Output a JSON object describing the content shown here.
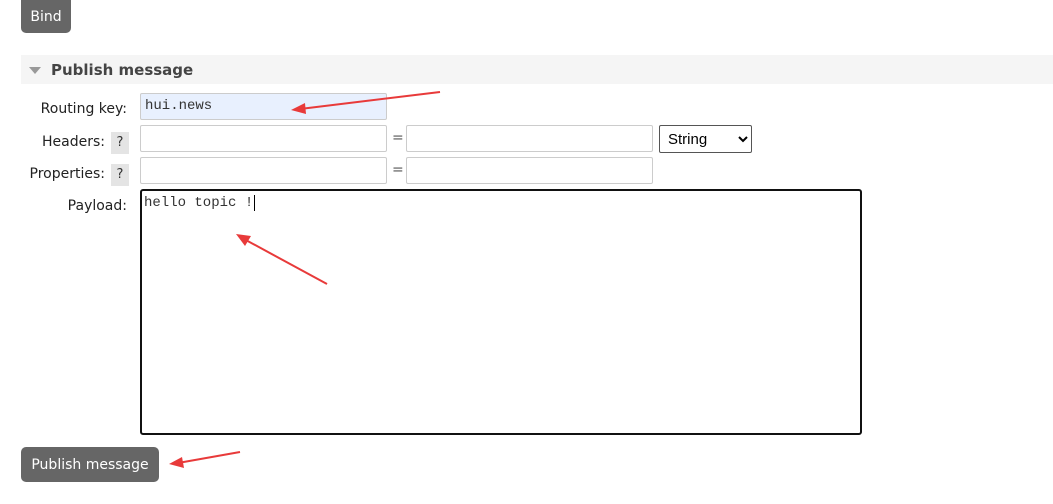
{
  "bind_button": "Bind",
  "section_title": "Publish message",
  "form": {
    "routing_key_label": "Routing key:",
    "routing_key_value": "hui.news",
    "headers_label": "Headers:",
    "properties_label": "Properties:",
    "help": "?",
    "equals": "=",
    "header_type": "String",
    "payload_label": "Payload:",
    "payload_value": "hello topic !"
  },
  "publish_button": "Publish message",
  "annotation_color": "#e83a3a"
}
